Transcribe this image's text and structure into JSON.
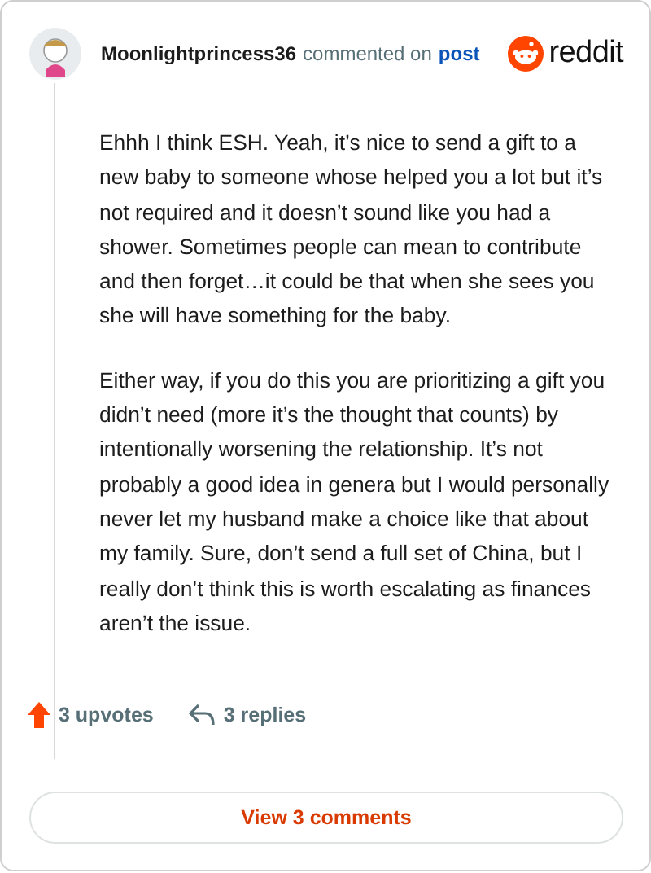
{
  "comment": {
    "author": "Moonlightprincess36",
    "action": "commented on",
    "link": "post",
    "brand": "reddit",
    "paragraphs": [
      "Ehhh I think ESH. Yeah, it’s nice to send a gift to a new baby to someone whose helped you a lot but it’s not required and it doesn’t sound like you had a shower. Sometimes people can mean to contribute and then forget…it could be that when she sees you she will have something for the baby.",
      "Either way, if you do this you are prioritizing a gift you didn’t need (more it’s the thought that counts) by intentionally worsening the relationship. It’s not probably a good idea in genera but I would personally never let my husband make a choice like that about my family. Sure, don’t send a full set of China, but I really don’t think this is worth escalating as finances aren’t the issue."
    ],
    "upvotes": "3 upvotes",
    "upvoted": true,
    "replies": "3 replies"
  },
  "button": "View 3 comments"
}
